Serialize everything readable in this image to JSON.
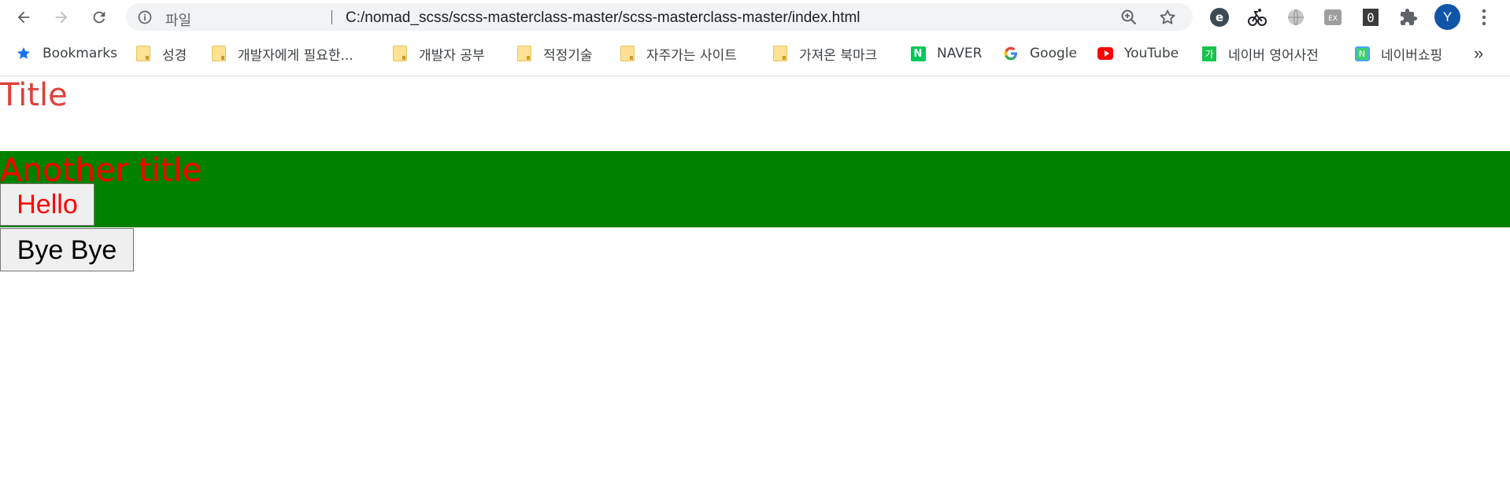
{
  "browser": {
    "scheme_label": "파일",
    "url": "C:/nomad_scss/scss-masterclass-master/scss-masterclass-master/index.html",
    "profile_initial": "Y"
  },
  "bookmarks": {
    "items": [
      {
        "label": "Bookmarks",
        "icon": "star-icon"
      },
      {
        "label": "성경",
        "icon": "folder-icon"
      },
      {
        "label": "개발자에게 필요한...",
        "icon": "folder-icon"
      },
      {
        "label": "개발자 공부",
        "icon": "folder-icon"
      },
      {
        "label": "적정기술",
        "icon": "folder-icon"
      },
      {
        "label": "자주가는 사이트",
        "icon": "folder-icon"
      },
      {
        "label": "가져온 북마크",
        "icon": "folder-icon"
      },
      {
        "label": "NAVER",
        "icon": "naver-icon"
      },
      {
        "label": "Google",
        "icon": "google-icon"
      },
      {
        "label": "YouTube",
        "icon": "youtube-icon"
      },
      {
        "label": "네이버 영어사전",
        "icon": "dictionary-icon"
      },
      {
        "label": "네이버쇼핑",
        "icon": "shopping-icon"
      }
    ],
    "overflow": "»"
  },
  "page": {
    "title": "Title",
    "another_title": "Another title",
    "hello_button": "Hello",
    "bye_button": "Bye Bye"
  },
  "colors": {
    "title": "#e0403a",
    "another_title": "#ff0000",
    "green_box": "#008000",
    "hello_text": "#ff0000"
  }
}
